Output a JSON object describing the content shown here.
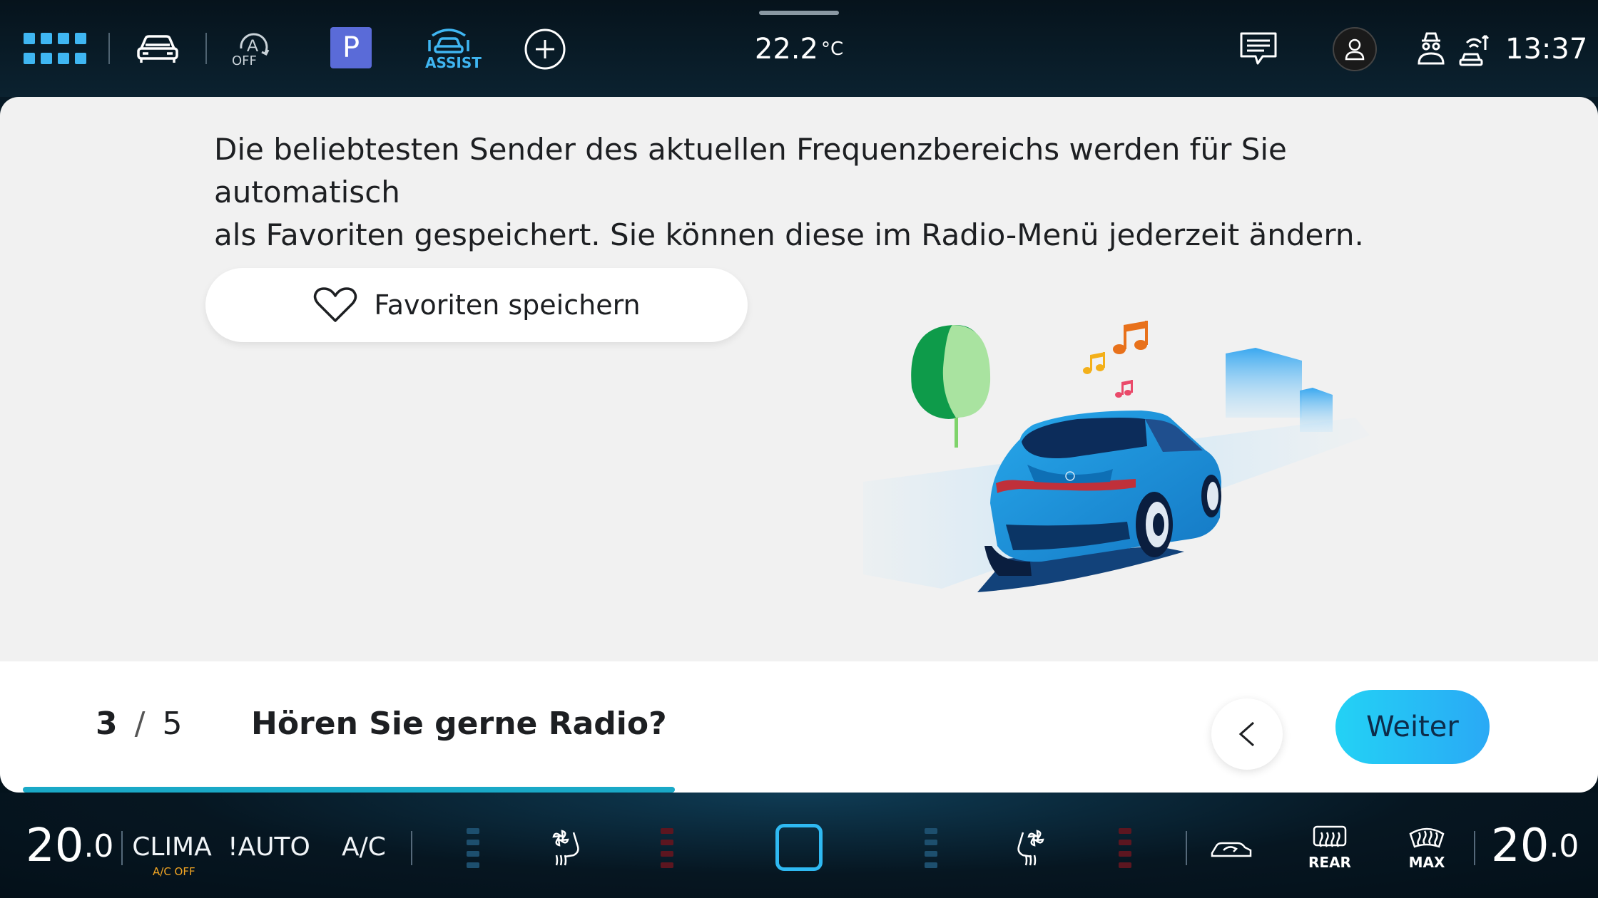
{
  "status_bar": {
    "temperature_value": "22.2",
    "temperature_unit": "°C",
    "time": "13:37",
    "auto_hold_label": "OFF",
    "park_label": "P",
    "assist_label": "ASSIST",
    "accent_color": "#3fb6f2"
  },
  "content": {
    "description_line1": "Die beliebtesten Sender des aktuellen Frequenzbereichs werden für Sie automatisch",
    "description_line2": "als Favoriten gespeichert. Sie können diese im Radio-Menü jederzeit ändern.",
    "favorites_button_label": "Favoriten speichern"
  },
  "flow": {
    "step_current": "3",
    "step_separator": "/",
    "step_total": "5",
    "question": "Hören Sie gerne Radio?",
    "next_label": "Weiter",
    "progress_fraction": 0.42
  },
  "climate": {
    "left_temp_main": "20",
    "left_temp_decimal": ".0",
    "right_temp_main": "20",
    "right_temp_decimal": ".0",
    "clima_label": "CLIMA",
    "clima_sub_label": "A/C OFF",
    "auto_label": "!AUTO",
    "ac_label": "A/C",
    "rear_label": "REAR",
    "max_label": "MAX"
  }
}
